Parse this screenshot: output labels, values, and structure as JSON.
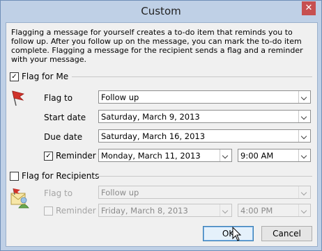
{
  "window": {
    "title": "Custom",
    "close_glyph": "✕"
  },
  "description": "Flagging a message for yourself creates a to-do item that reminds you to follow up. After you follow up on the message, you can mark the to-do item complete. Flagging a message for the recipient sends a flag and a reminder with your message.",
  "flag_for_me": {
    "label": "Flag for Me",
    "checked": true,
    "icon": "red-flag-icon",
    "flag_to": {
      "label": "Flag to",
      "value": "Follow up"
    },
    "start_date": {
      "label": "Start date",
      "value": "Saturday, March 9, 2013"
    },
    "due_date": {
      "label": "Due date",
      "value": "Saturday, March 16, 2013"
    },
    "reminder": {
      "label": "Reminder",
      "checked": true,
      "date": "Monday, March 11, 2013",
      "time": "9:00 AM"
    }
  },
  "flag_for_recipients": {
    "label": "Flag for Recipients",
    "checked": false,
    "icon": "recipient-flag-icon",
    "flag_to": {
      "label": "Flag to",
      "value": "Follow up"
    },
    "reminder": {
      "label": "Reminder",
      "checked": false,
      "date": "Friday, March 8, 2013",
      "time": "4:00 PM"
    }
  },
  "buttons": {
    "ok": "OK",
    "cancel": "Cancel"
  },
  "colors": {
    "title_bar": "#bfd0e6",
    "close_button": "#c75050",
    "flag_red": "#d0332b",
    "client_bg": "#f0f0f0"
  }
}
